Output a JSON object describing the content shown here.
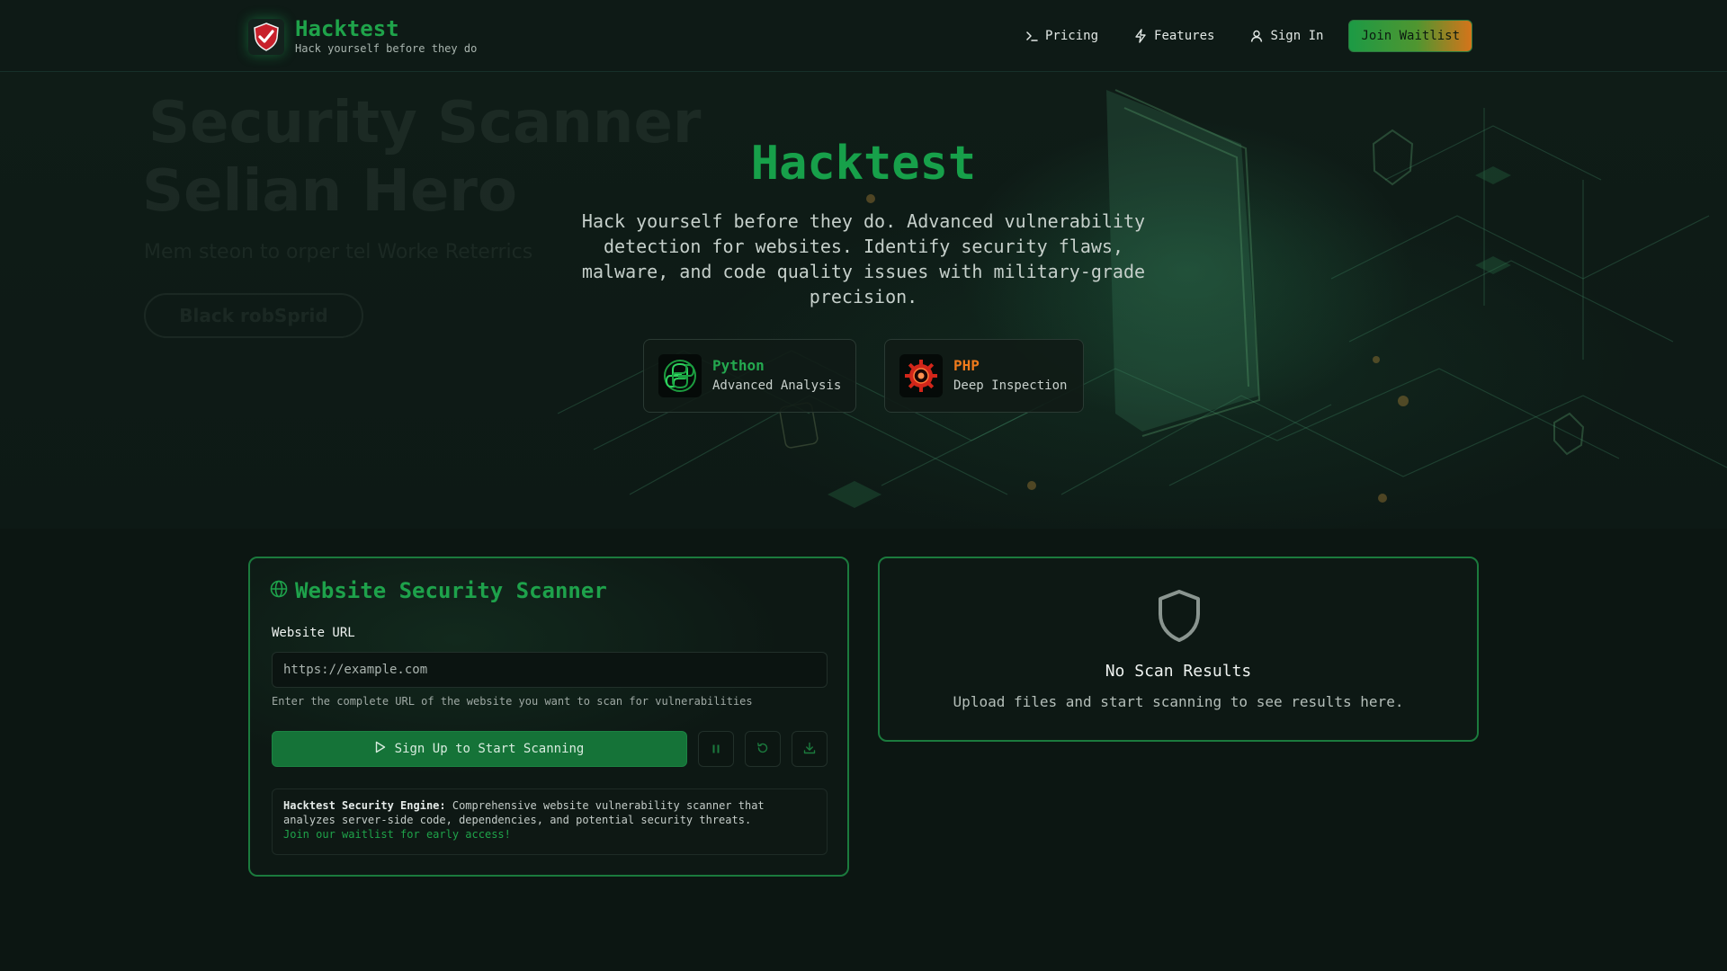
{
  "brand": {
    "name": "Hacktest",
    "tagline": "Hack yourself before they do"
  },
  "nav": {
    "pricing": "Pricing",
    "features": "Features",
    "sign_in": "Sign In",
    "join_waitlist": "Join Waitlist"
  },
  "hero_background": {
    "line1": "Security Scanner",
    "line2": "Selian Hero",
    "line3": "Mem steon to orper tel Worke Reterrics",
    "button": "Black robSprid"
  },
  "hero": {
    "title": "Hacktest",
    "description": "Hack yourself before they do. Advanced vulnerability detection for websites. Identify security flaws, malware, and code quality issues with military-grade precision."
  },
  "languages": [
    {
      "name": "Python",
      "subtitle": "Advanced Analysis",
      "icon": "python-icon",
      "color": "#24a84f"
    },
    {
      "name": "PHP",
      "subtitle": "Deep Inspection",
      "icon": "php-gear-icon",
      "color": "#ee7a1c"
    }
  ],
  "scanner": {
    "title": "Website Security Scanner",
    "url_label": "Website URL",
    "url_placeholder": "https://example.com",
    "url_value": "",
    "url_hint": "Enter the complete URL of the website you want to scan for vulnerabilities",
    "start_button": "Sign Up to Start Scanning",
    "engine_label": "Hacktest Security Engine:",
    "engine_text": "Comprehensive website vulnerability scanner that analyzes server-side code, dependencies, and potential security threats.",
    "engine_link": "Join our waitlist for early access!"
  },
  "results": {
    "title": "No Scan Results",
    "subtitle": "Upload files and start scanning to see results here."
  },
  "colors": {
    "accent": "#1fa34a",
    "accent_dark": "#157338",
    "php_orange": "#ee7a1c",
    "background": "#0c1612"
  }
}
